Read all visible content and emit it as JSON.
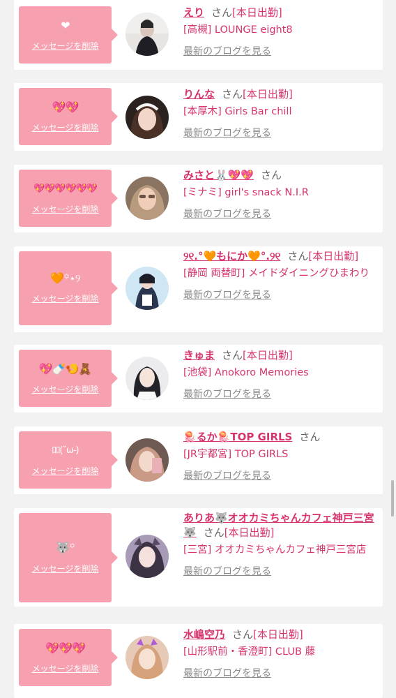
{
  "common": {
    "delete_label": "メッセージを削除",
    "san": "さん",
    "blog_label": "最新のブログを見る"
  },
  "colors": {
    "bubble": "#f7a1b0",
    "name": "#d7346f",
    "background": "#f3f2f3"
  },
  "items": [
    {
      "emoji": "❤",
      "name": "えり",
      "attendance": "[本日出勤]",
      "shop": "[高槻] LOUNGE eight8",
      "avatar": "avatar-photo"
    },
    {
      "emoji": "💖💖",
      "name": "りんな",
      "attendance": "[本日出勤]",
      "shop": "[本厚木] Girls Bar chill",
      "avatar": "avatar-photo"
    },
    {
      "emoji": "💖💖💖💖💖💖",
      "name": "みさと🐰💖💖",
      "attendance": "",
      "shop": "[ミナミ] girl's snack N.I.R",
      "avatar": "avatar-photo"
    },
    {
      "emoji": "🧡꙳⋆୨",
      "name": "୨୧.°🧡もにか🧡°.୨୧",
      "attendance": "[本日出勤]",
      "shop": "[静岡 両替町] メイドダイニングひまわり",
      "avatar": "avatar-photo"
    },
    {
      "emoji": "💖🍼🍤🧸",
      "name": "きゅま",
      "attendance": "[本日出勤]",
      "shop": "[池袋] Anokoro Memories",
      "avatar": "avatar-photo"
    },
    {
      "emoji": "ﾛﾛ(˘ω-)",
      "name": "🪼るか🪼TOP GIRLS",
      "attendance": "",
      "shop": "[JR宇都宮] TOP GIRLS",
      "avatar": "avatar-photo"
    },
    {
      "emoji": "🐺꙳",
      "name": "ありあ🐺オオカミちゃんカフェ神戸三宮🐺",
      "attendance": "[本日出勤]",
      "shop": "[三宮] オオカミちゃんカフェ神戸三宮店",
      "avatar": "avatar-photo"
    },
    {
      "emoji": "💖💖💖",
      "name": "水嶋空乃",
      "attendance": "[本日出勤]",
      "shop": "[山形駅前・香澄町] CLUB 藤",
      "avatar": "avatar-photo"
    }
  ]
}
